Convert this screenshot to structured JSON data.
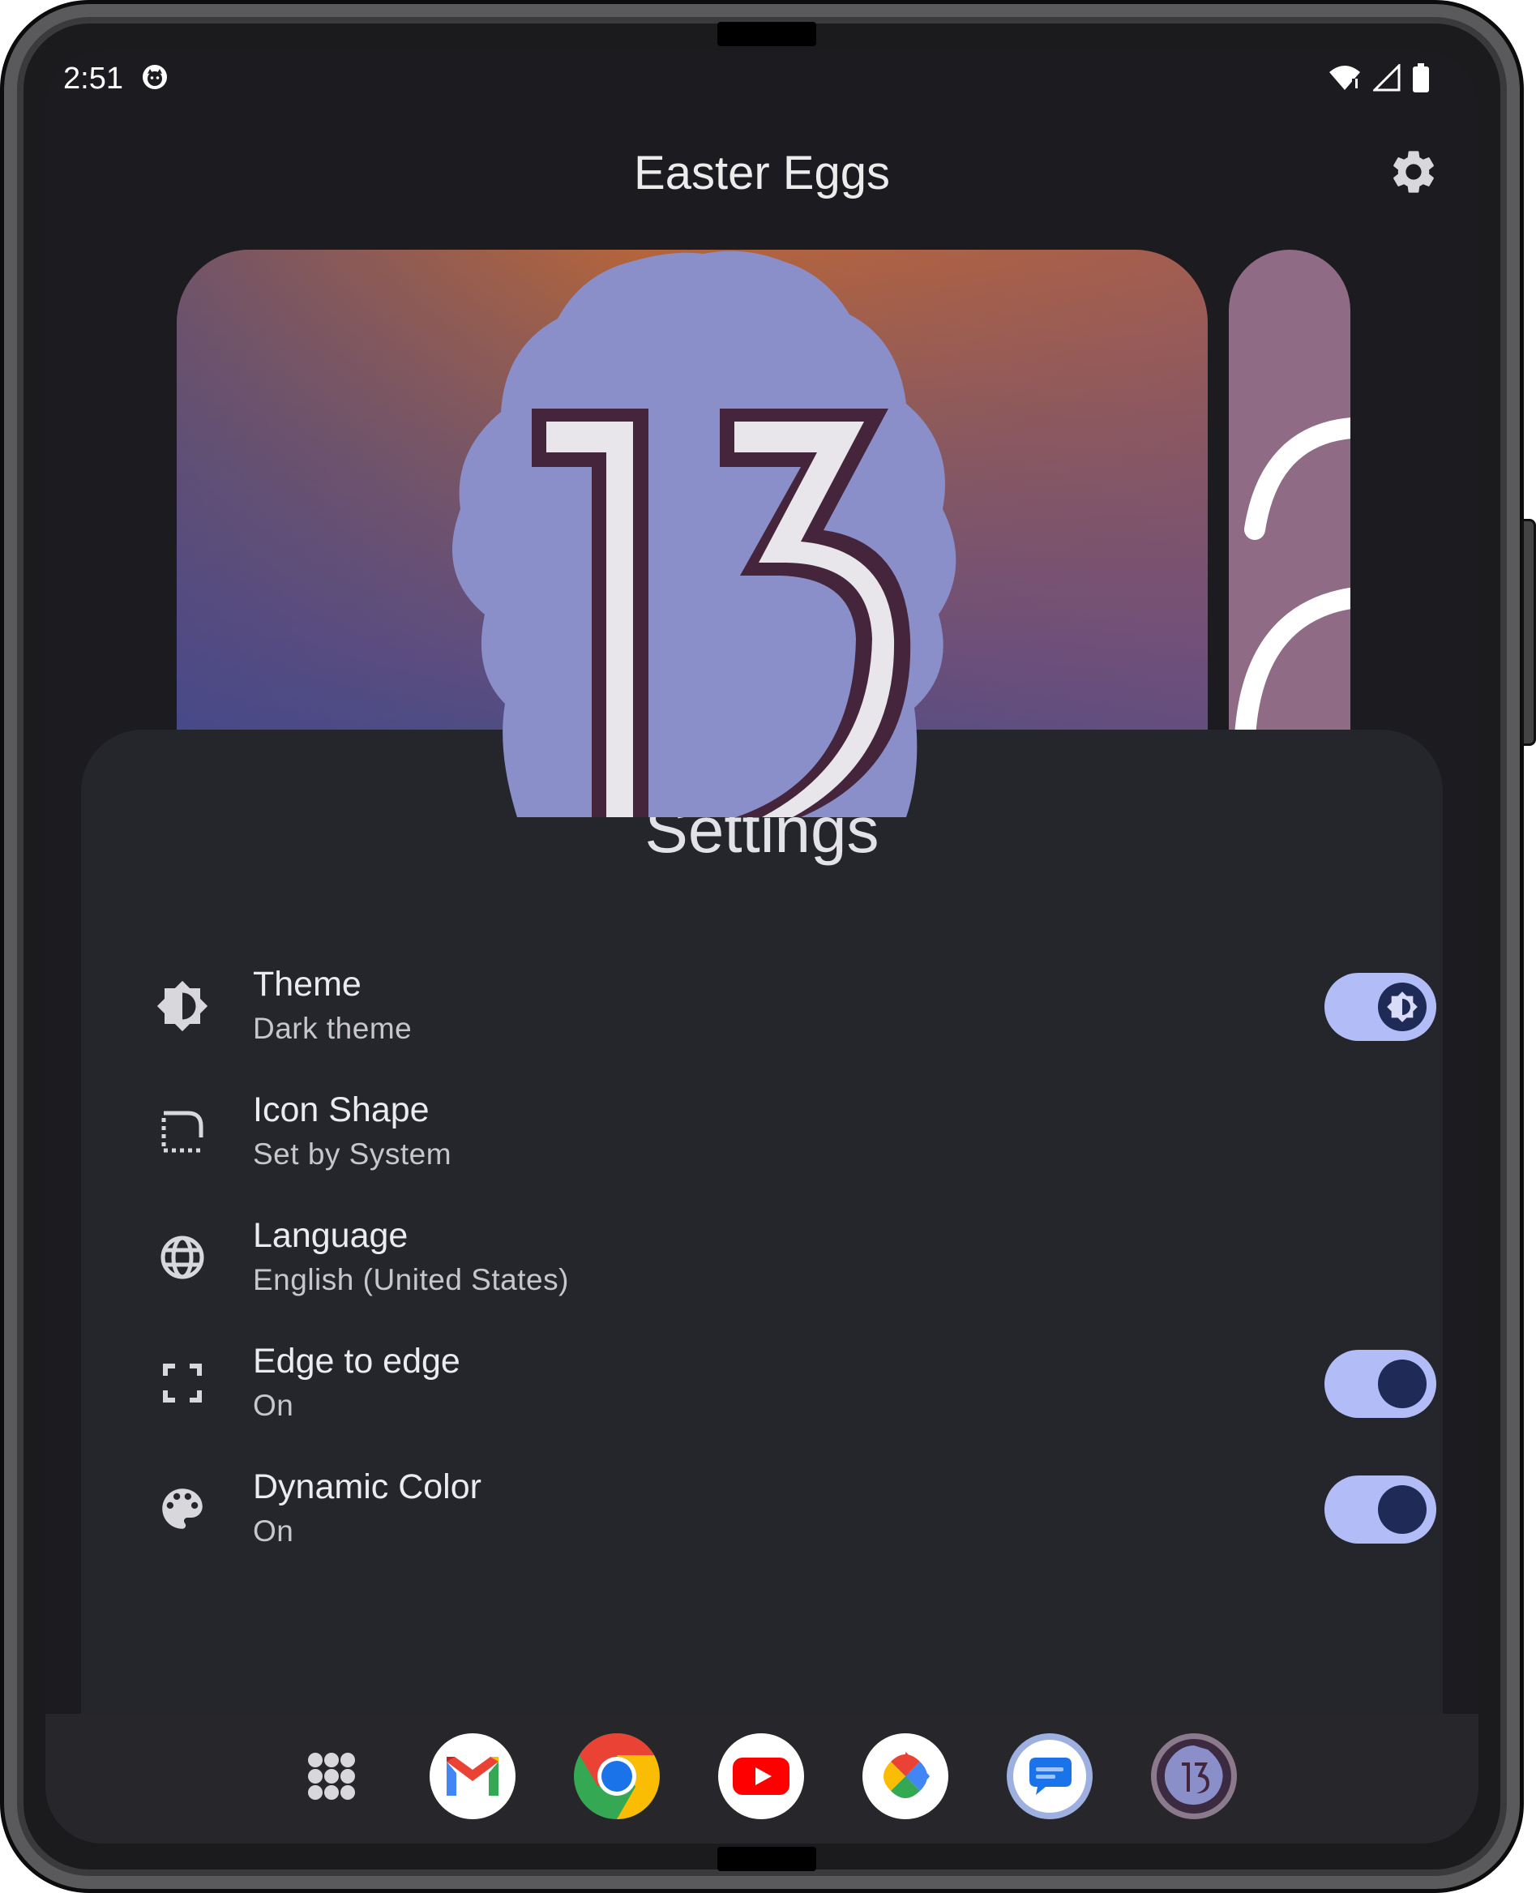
{
  "status_bar": {
    "time": "2:51",
    "icons": [
      "cat-notification-icon",
      "wifi-icon",
      "signal-icon",
      "battery-icon"
    ]
  },
  "app_bar": {
    "title": "Easter Eggs",
    "settings_icon": "gear-icon"
  },
  "carousel": {
    "main_card_number": "13"
  },
  "sheet": {
    "title": "Settings",
    "items": [
      {
        "icon": "brightness-icon",
        "title": "Theme",
        "subtitle": "Dark theme",
        "toggle": true,
        "toggle_on": true
      },
      {
        "icon": "icon-shape-icon",
        "title": "Icon Shape",
        "subtitle": "Set by System",
        "toggle": false
      },
      {
        "icon": "globe-icon",
        "title": "Language",
        "subtitle": "English (United States)",
        "toggle": false
      },
      {
        "icon": "fullscreen-icon",
        "title": "Edge to edge",
        "subtitle": "On",
        "toggle": true,
        "toggle_on": true
      },
      {
        "icon": "palette-icon",
        "title": "Dynamic Color",
        "subtitle": "On",
        "toggle": true,
        "toggle_on": true
      }
    ]
  },
  "dock": {
    "apps": [
      "app-drawer-icon",
      "gmail-icon",
      "chrome-icon",
      "youtube-icon",
      "photos-icon",
      "messages-icon",
      "easter-eggs-13-icon"
    ]
  },
  "colors": {
    "background": "#1c1b1f",
    "sheet": "#25262b",
    "toggle_track": "#b2bdf8",
    "toggle_thumb": "#202a56",
    "badge_blue": "#8a8fca",
    "number_dark": "#45253b"
  }
}
